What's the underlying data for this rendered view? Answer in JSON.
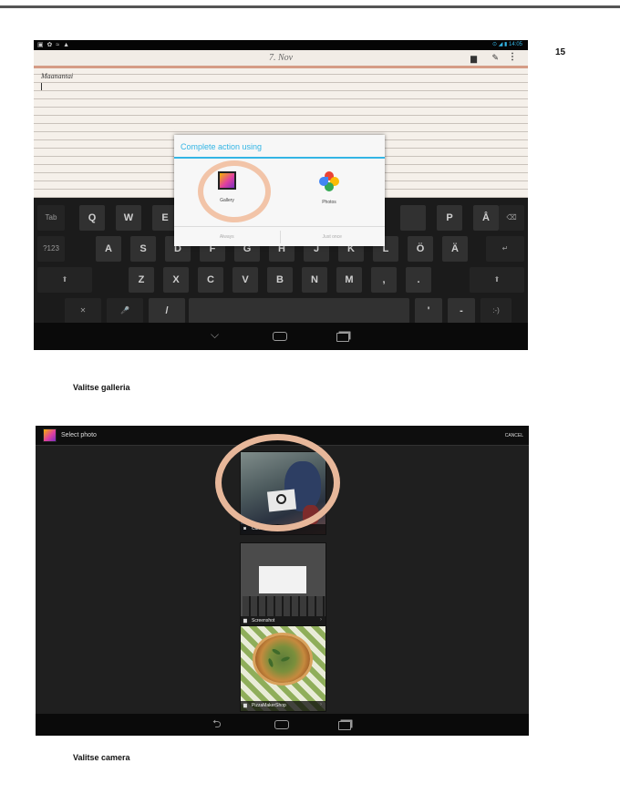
{
  "page": {
    "number": "15"
  },
  "screenshot1": {
    "status_icons": "▣ ✿ ≈ ▲",
    "status_right": "⊙ ◢ ▮ 14:05",
    "notepad": {
      "date": "7. Nov",
      "text": "Maanantai"
    },
    "dialog": {
      "title": "Complete action using",
      "apps": [
        {
          "label": "Gallery",
          "icon": "gallery-icon"
        },
        {
          "label": "Photos",
          "icon": "photos-icon"
        }
      ],
      "buttons": [
        "Always",
        "Just once"
      ]
    },
    "keyboard": {
      "row1": [
        "Tab",
        "Q",
        "W",
        "E",
        "",
        "",
        "",
        "",
        "",
        "P",
        "Å",
        "⌫"
      ],
      "row2": [
        "?123",
        "A",
        "S",
        "D",
        "F",
        "G",
        "H",
        "J",
        "K",
        "L",
        "Ö",
        "Ä",
        "↵"
      ],
      "row3": [
        "⬆",
        "Z",
        "X",
        "C",
        "V",
        "B",
        "N",
        "M",
        ",",
        ".",
        "⬆"
      ],
      "row4": [
        "✕",
        "🎤",
        "/",
        "",
        "'",
        "-",
        ":-)"
      ]
    }
  },
  "caption1": "Valitse galleria",
  "screenshot2": {
    "title": "Select photo",
    "cancel": "CANCEL",
    "albums": [
      {
        "label": "Camera"
      },
      {
        "label": "Screenshot"
      },
      {
        "label": "PizzaMakerShop"
      }
    ]
  },
  "caption2": "Valitse camera",
  "colors": {
    "holo_blue": "#33b5e5",
    "highlight_ring": "#f2c4a8"
  }
}
